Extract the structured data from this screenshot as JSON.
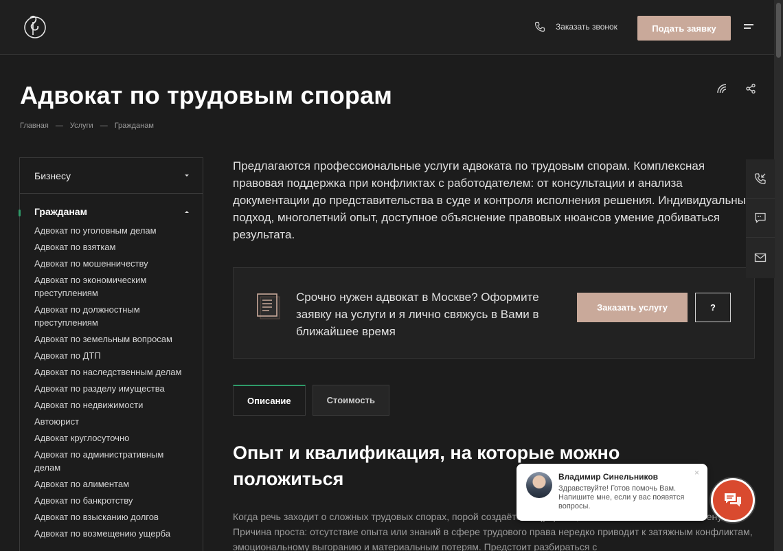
{
  "header": {
    "callback_label": "Заказать звонок",
    "apply_label": "Подать заявку"
  },
  "page": {
    "title": "Адвокат по трудовым спорам",
    "breadcrumb": [
      "Главная",
      "Услуги",
      "Гражданам"
    ],
    "breadcrumb_sep": "—"
  },
  "sidebar": {
    "business_label": "Бизнесу",
    "citizens_label": "Гражданам",
    "items": [
      "Адвокат по уголовным делам",
      "Адвокат по взяткам",
      "Адвокат по мошенничеству",
      "Адвокат по экономическим преступлениям",
      "Адвокат по должностным преступлениям",
      "Адвокат по земельным вопросам",
      "Адвокат по ДТП",
      "Адвокат по наследственным делам",
      "Адвокат по разделу имущества",
      "Адвокат по недвижимости",
      "Автоюрист",
      "Адвокат круглосуточно",
      "Адвокат по административным делам",
      "Адвокат по алиментам",
      "Адвокат по банкротству",
      "Адвокат по взысканию долгов",
      "Адвокат по возмещению ущерба"
    ]
  },
  "intro": "Предлагаются профессиональные услуги адвоката по трудовым спорам. Комплексная правовая поддержка при конфликтах с работодателем: от консультации и анализа документации до представительства в суде и контроля исполнения решения. Индивидуальный подход, многолетний опыт, доступное объяснение правовых нюансов умение добиваться результата.",
  "cta": {
    "text": "Срочно нужен адвокат в Москве? Оформите заявку на услуги и я лично свяжусь в Вами в ближайшее время",
    "order_label": "Заказать услугу",
    "question_label": "?"
  },
  "tabs": [
    {
      "label": "Описание",
      "active": true
    },
    {
      "label": "Стоимость",
      "active": false
    }
  ],
  "section": {
    "title": "Опыт и квалификация, на которые можно положиться",
    "body": "Когда речь заходит о сложных трудовых спорах, порой создаётся ощущение, что вы бьётесь головой о стену. Причина проста: отсутствие опыта или знаний в сфере трудового права нередко приводит к затяжным конфликтам, эмоциональному выгоранию и материальным потерям. Предстоит разбираться с"
  },
  "chat": {
    "name": "Владимир Синельников",
    "message": "Здравствуйте! Готов помочь Вам. Напишите мне, если у вас появятся вопросы.",
    "close": "×"
  },
  "colors": {
    "background": "#1c1c1c",
    "accent": "#c9a99a",
    "active_marker": "#2f9c6a",
    "chat_button": "#d94a2f"
  },
  "icons": [
    "logo-icon",
    "phone-icon",
    "menu-icon",
    "rss-icon",
    "share-icon",
    "document-icon",
    "phone-incoming-icon",
    "chat-icon",
    "mail-icon",
    "chat-bubbles-icon"
  ]
}
